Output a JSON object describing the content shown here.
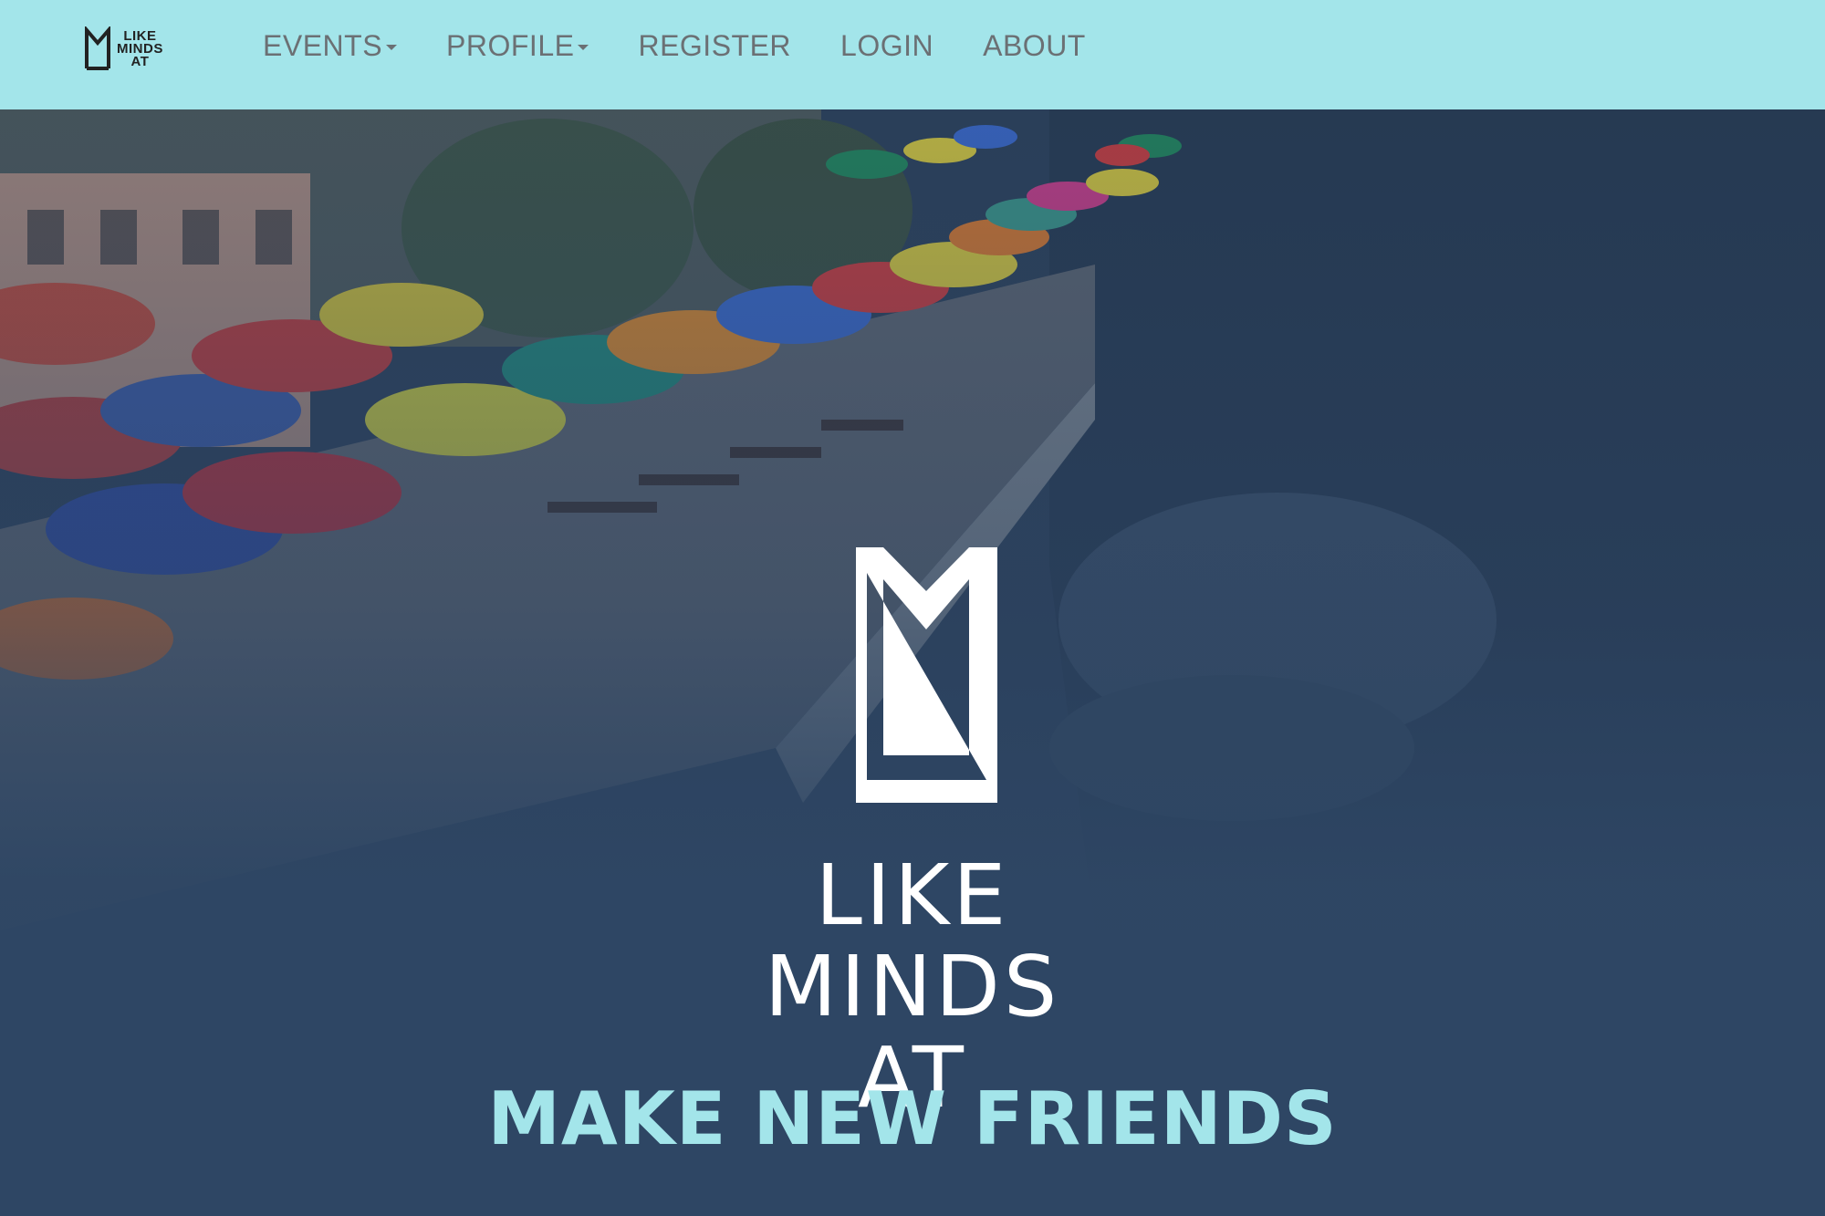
{
  "nav": {
    "logo_lines": [
      "LIKE",
      "MINDS",
      "AT"
    ],
    "items": [
      {
        "label": "EVENTS",
        "dropdown": true
      },
      {
        "label": "PROFILE",
        "dropdown": true
      },
      {
        "label": "REGISTER",
        "dropdown": false
      },
      {
        "label": "LOGIN",
        "dropdown": false
      },
      {
        "label": "ABOUT",
        "dropdown": false
      }
    ]
  },
  "hero": {
    "brand_lines": [
      "LIKE",
      "MINDS",
      "AT"
    ],
    "tagline": "MAKE NEW FRIENDS"
  },
  "colors": {
    "navbar_bg": "#a3e5ea",
    "nav_text": "#6b7074",
    "hero_bg": "#2e4764",
    "tagline": "#a3e5ea",
    "brand_text": "#ffffff"
  }
}
